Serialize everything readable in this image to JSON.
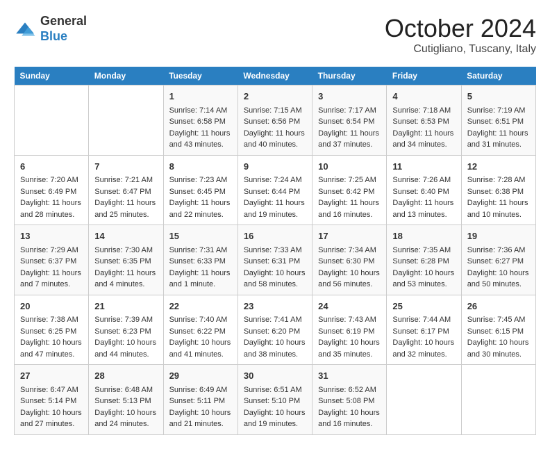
{
  "header": {
    "logo_general": "General",
    "logo_blue": "Blue",
    "month_title": "October 2024",
    "location": "Cutigliano, Tuscany, Italy"
  },
  "days_of_week": [
    "Sunday",
    "Monday",
    "Tuesday",
    "Wednesday",
    "Thursday",
    "Friday",
    "Saturday"
  ],
  "weeks": [
    [
      {
        "day": "",
        "content": ""
      },
      {
        "day": "",
        "content": ""
      },
      {
        "day": "1",
        "sunrise": "Sunrise: 7:14 AM",
        "sunset": "Sunset: 6:58 PM",
        "daylight": "Daylight: 11 hours and 43 minutes."
      },
      {
        "day": "2",
        "sunrise": "Sunrise: 7:15 AM",
        "sunset": "Sunset: 6:56 PM",
        "daylight": "Daylight: 11 hours and 40 minutes."
      },
      {
        "day": "3",
        "sunrise": "Sunrise: 7:17 AM",
        "sunset": "Sunset: 6:54 PM",
        "daylight": "Daylight: 11 hours and 37 minutes."
      },
      {
        "day": "4",
        "sunrise": "Sunrise: 7:18 AM",
        "sunset": "Sunset: 6:53 PM",
        "daylight": "Daylight: 11 hours and 34 minutes."
      },
      {
        "day": "5",
        "sunrise": "Sunrise: 7:19 AM",
        "sunset": "Sunset: 6:51 PM",
        "daylight": "Daylight: 11 hours and 31 minutes."
      }
    ],
    [
      {
        "day": "6",
        "sunrise": "Sunrise: 7:20 AM",
        "sunset": "Sunset: 6:49 PM",
        "daylight": "Daylight: 11 hours and 28 minutes."
      },
      {
        "day": "7",
        "sunrise": "Sunrise: 7:21 AM",
        "sunset": "Sunset: 6:47 PM",
        "daylight": "Daylight: 11 hours and 25 minutes."
      },
      {
        "day": "8",
        "sunrise": "Sunrise: 7:23 AM",
        "sunset": "Sunset: 6:45 PM",
        "daylight": "Daylight: 11 hours and 22 minutes."
      },
      {
        "day": "9",
        "sunrise": "Sunrise: 7:24 AM",
        "sunset": "Sunset: 6:44 PM",
        "daylight": "Daylight: 11 hours and 19 minutes."
      },
      {
        "day": "10",
        "sunrise": "Sunrise: 7:25 AM",
        "sunset": "Sunset: 6:42 PM",
        "daylight": "Daylight: 11 hours and 16 minutes."
      },
      {
        "day": "11",
        "sunrise": "Sunrise: 7:26 AM",
        "sunset": "Sunset: 6:40 PM",
        "daylight": "Daylight: 11 hours and 13 minutes."
      },
      {
        "day": "12",
        "sunrise": "Sunrise: 7:28 AM",
        "sunset": "Sunset: 6:38 PM",
        "daylight": "Daylight: 11 hours and 10 minutes."
      }
    ],
    [
      {
        "day": "13",
        "sunrise": "Sunrise: 7:29 AM",
        "sunset": "Sunset: 6:37 PM",
        "daylight": "Daylight: 11 hours and 7 minutes."
      },
      {
        "day": "14",
        "sunrise": "Sunrise: 7:30 AM",
        "sunset": "Sunset: 6:35 PM",
        "daylight": "Daylight: 11 hours and 4 minutes."
      },
      {
        "day": "15",
        "sunrise": "Sunrise: 7:31 AM",
        "sunset": "Sunset: 6:33 PM",
        "daylight": "Daylight: 11 hours and 1 minute."
      },
      {
        "day": "16",
        "sunrise": "Sunrise: 7:33 AM",
        "sunset": "Sunset: 6:31 PM",
        "daylight": "Daylight: 10 hours and 58 minutes."
      },
      {
        "day": "17",
        "sunrise": "Sunrise: 7:34 AM",
        "sunset": "Sunset: 6:30 PM",
        "daylight": "Daylight: 10 hours and 56 minutes."
      },
      {
        "day": "18",
        "sunrise": "Sunrise: 7:35 AM",
        "sunset": "Sunset: 6:28 PM",
        "daylight": "Daylight: 10 hours and 53 minutes."
      },
      {
        "day": "19",
        "sunrise": "Sunrise: 7:36 AM",
        "sunset": "Sunset: 6:27 PM",
        "daylight": "Daylight: 10 hours and 50 minutes."
      }
    ],
    [
      {
        "day": "20",
        "sunrise": "Sunrise: 7:38 AM",
        "sunset": "Sunset: 6:25 PM",
        "daylight": "Daylight: 10 hours and 47 minutes."
      },
      {
        "day": "21",
        "sunrise": "Sunrise: 7:39 AM",
        "sunset": "Sunset: 6:23 PM",
        "daylight": "Daylight: 10 hours and 44 minutes."
      },
      {
        "day": "22",
        "sunrise": "Sunrise: 7:40 AM",
        "sunset": "Sunset: 6:22 PM",
        "daylight": "Daylight: 10 hours and 41 minutes."
      },
      {
        "day": "23",
        "sunrise": "Sunrise: 7:41 AM",
        "sunset": "Sunset: 6:20 PM",
        "daylight": "Daylight: 10 hours and 38 minutes."
      },
      {
        "day": "24",
        "sunrise": "Sunrise: 7:43 AM",
        "sunset": "Sunset: 6:19 PM",
        "daylight": "Daylight: 10 hours and 35 minutes."
      },
      {
        "day": "25",
        "sunrise": "Sunrise: 7:44 AM",
        "sunset": "Sunset: 6:17 PM",
        "daylight": "Daylight: 10 hours and 32 minutes."
      },
      {
        "day": "26",
        "sunrise": "Sunrise: 7:45 AM",
        "sunset": "Sunset: 6:15 PM",
        "daylight": "Daylight: 10 hours and 30 minutes."
      }
    ],
    [
      {
        "day": "27",
        "sunrise": "Sunrise: 6:47 AM",
        "sunset": "Sunset: 5:14 PM",
        "daylight": "Daylight: 10 hours and 27 minutes."
      },
      {
        "day": "28",
        "sunrise": "Sunrise: 6:48 AM",
        "sunset": "Sunset: 5:13 PM",
        "daylight": "Daylight: 10 hours and 24 minutes."
      },
      {
        "day": "29",
        "sunrise": "Sunrise: 6:49 AM",
        "sunset": "Sunset: 5:11 PM",
        "daylight": "Daylight: 10 hours and 21 minutes."
      },
      {
        "day": "30",
        "sunrise": "Sunrise: 6:51 AM",
        "sunset": "Sunset: 5:10 PM",
        "daylight": "Daylight: 10 hours and 19 minutes."
      },
      {
        "day": "31",
        "sunrise": "Sunrise: 6:52 AM",
        "sunset": "Sunset: 5:08 PM",
        "daylight": "Daylight: 10 hours and 16 minutes."
      },
      {
        "day": "",
        "content": ""
      },
      {
        "day": "",
        "content": ""
      }
    ]
  ]
}
